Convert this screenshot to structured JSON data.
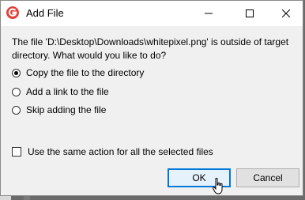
{
  "dialog": {
    "title": "Add File",
    "message": "The file 'D:\\Desktop\\Downloads\\whitepixel.png' is outside of target directory. What would you like to do?",
    "options": [
      {
        "label": "Copy the file to the directory",
        "selected": true
      },
      {
        "label": "Add a link to the file",
        "selected": false
      },
      {
        "label": "Skip adding the file",
        "selected": false
      }
    ],
    "same_action_label": "Use the same action for all the selected files",
    "same_action_checked": false,
    "ok_label": "OK",
    "cancel_label": "Cancel"
  },
  "icons": {
    "app": "app-logo-icon",
    "minimize": "minimize-icon",
    "maximize": "maximize-icon",
    "close": "close-icon",
    "cursor": "mouse-pointer-icon"
  },
  "colors": {
    "accent": "#0078d7",
    "app_icon": "#e0423a"
  }
}
